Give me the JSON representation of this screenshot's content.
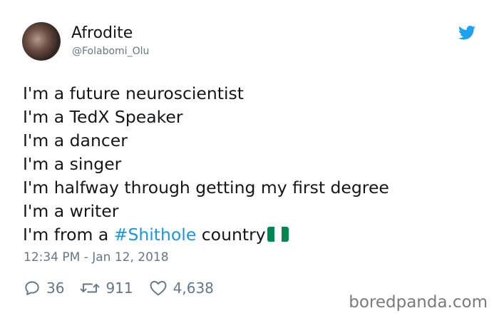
{
  "author": {
    "display_name": "Afrodite",
    "handle": "@Folabomi_Olu"
  },
  "tweet": {
    "lines": [
      "I'm a future neuroscientist",
      "I'm a TedX Speaker",
      "I'm a dancer",
      "I'm a singer",
      "I'm halfway through getting my first degree",
      "I'm a writer"
    ],
    "last_line_prefix": "I'm from a ",
    "hashtag": "#Shithole",
    "last_line_suffix": " country"
  },
  "timestamp": "12:34 PM - Jan 12, 2018",
  "actions": {
    "replies": "36",
    "retweets": "911",
    "likes": "4,638"
  },
  "watermark": "boredpanda.com",
  "colors": {
    "link": "#1b95e0",
    "muted": "#657786",
    "twitter_blue": "#1da1f2",
    "flag_green": "#008751"
  }
}
